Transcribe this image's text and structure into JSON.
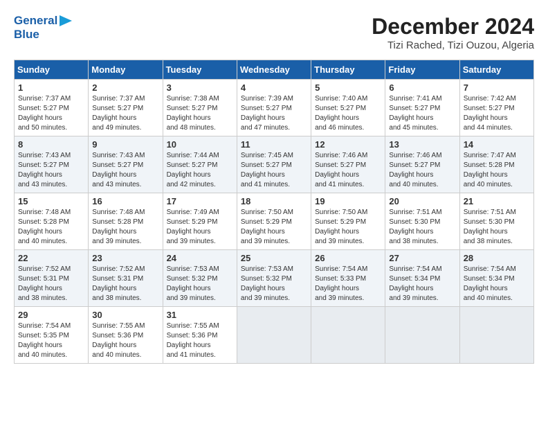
{
  "header": {
    "logo_line1": "General",
    "logo_line2": "Blue",
    "title": "December 2024",
    "subtitle": "Tizi Rached, Tizi Ouzou, Algeria"
  },
  "calendar": {
    "days_of_week": [
      "Sunday",
      "Monday",
      "Tuesday",
      "Wednesday",
      "Thursday",
      "Friday",
      "Saturday"
    ],
    "weeks": [
      [
        {
          "day": "1",
          "sunrise": "7:37 AM",
          "sunset": "5:27 PM",
          "daylight": "9 hours and 50 minutes."
        },
        {
          "day": "2",
          "sunrise": "7:37 AM",
          "sunset": "5:27 PM",
          "daylight": "9 hours and 49 minutes."
        },
        {
          "day": "3",
          "sunrise": "7:38 AM",
          "sunset": "5:27 PM",
          "daylight": "9 hours and 48 minutes."
        },
        {
          "day": "4",
          "sunrise": "7:39 AM",
          "sunset": "5:27 PM",
          "daylight": "9 hours and 47 minutes."
        },
        {
          "day": "5",
          "sunrise": "7:40 AM",
          "sunset": "5:27 PM",
          "daylight": "9 hours and 46 minutes."
        },
        {
          "day": "6",
          "sunrise": "7:41 AM",
          "sunset": "5:27 PM",
          "daylight": "9 hours and 45 minutes."
        },
        {
          "day": "7",
          "sunrise": "7:42 AM",
          "sunset": "5:27 PM",
          "daylight": "9 hours and 44 minutes."
        }
      ],
      [
        {
          "day": "8",
          "sunrise": "7:43 AM",
          "sunset": "5:27 PM",
          "daylight": "9 hours and 43 minutes."
        },
        {
          "day": "9",
          "sunrise": "7:43 AM",
          "sunset": "5:27 PM",
          "daylight": "9 hours and 43 minutes."
        },
        {
          "day": "10",
          "sunrise": "7:44 AM",
          "sunset": "5:27 PM",
          "daylight": "9 hours and 42 minutes."
        },
        {
          "day": "11",
          "sunrise": "7:45 AM",
          "sunset": "5:27 PM",
          "daylight": "9 hours and 41 minutes."
        },
        {
          "day": "12",
          "sunrise": "7:46 AM",
          "sunset": "5:27 PM",
          "daylight": "9 hours and 41 minutes."
        },
        {
          "day": "13",
          "sunrise": "7:46 AM",
          "sunset": "5:27 PM",
          "daylight": "9 hours and 40 minutes."
        },
        {
          "day": "14",
          "sunrise": "7:47 AM",
          "sunset": "5:28 PM",
          "daylight": "9 hours and 40 minutes."
        }
      ],
      [
        {
          "day": "15",
          "sunrise": "7:48 AM",
          "sunset": "5:28 PM",
          "daylight": "9 hours and 40 minutes."
        },
        {
          "day": "16",
          "sunrise": "7:48 AM",
          "sunset": "5:28 PM",
          "daylight": "9 hours and 39 minutes."
        },
        {
          "day": "17",
          "sunrise": "7:49 AM",
          "sunset": "5:29 PM",
          "daylight": "9 hours and 39 minutes."
        },
        {
          "day": "18",
          "sunrise": "7:50 AM",
          "sunset": "5:29 PM",
          "daylight": "9 hours and 39 minutes."
        },
        {
          "day": "19",
          "sunrise": "7:50 AM",
          "sunset": "5:29 PM",
          "daylight": "9 hours and 39 minutes."
        },
        {
          "day": "20",
          "sunrise": "7:51 AM",
          "sunset": "5:30 PM",
          "daylight": "9 hours and 38 minutes."
        },
        {
          "day": "21",
          "sunrise": "7:51 AM",
          "sunset": "5:30 PM",
          "daylight": "9 hours and 38 minutes."
        }
      ],
      [
        {
          "day": "22",
          "sunrise": "7:52 AM",
          "sunset": "5:31 PM",
          "daylight": "9 hours and 38 minutes."
        },
        {
          "day": "23",
          "sunrise": "7:52 AM",
          "sunset": "5:31 PM",
          "daylight": "9 hours and 38 minutes."
        },
        {
          "day": "24",
          "sunrise": "7:53 AM",
          "sunset": "5:32 PM",
          "daylight": "9 hours and 39 minutes."
        },
        {
          "day": "25",
          "sunrise": "7:53 AM",
          "sunset": "5:32 PM",
          "daylight": "9 hours and 39 minutes."
        },
        {
          "day": "26",
          "sunrise": "7:54 AM",
          "sunset": "5:33 PM",
          "daylight": "9 hours and 39 minutes."
        },
        {
          "day": "27",
          "sunrise": "7:54 AM",
          "sunset": "5:34 PM",
          "daylight": "9 hours and 39 minutes."
        },
        {
          "day": "28",
          "sunrise": "7:54 AM",
          "sunset": "5:34 PM",
          "daylight": "9 hours and 40 minutes."
        }
      ],
      [
        {
          "day": "29",
          "sunrise": "7:54 AM",
          "sunset": "5:35 PM",
          "daylight": "9 hours and 40 minutes."
        },
        {
          "day": "30",
          "sunrise": "7:55 AM",
          "sunset": "5:36 PM",
          "daylight": "9 hours and 40 minutes."
        },
        {
          "day": "31",
          "sunrise": "7:55 AM",
          "sunset": "5:36 PM",
          "daylight": "9 hours and 41 minutes."
        },
        null,
        null,
        null,
        null
      ]
    ]
  }
}
